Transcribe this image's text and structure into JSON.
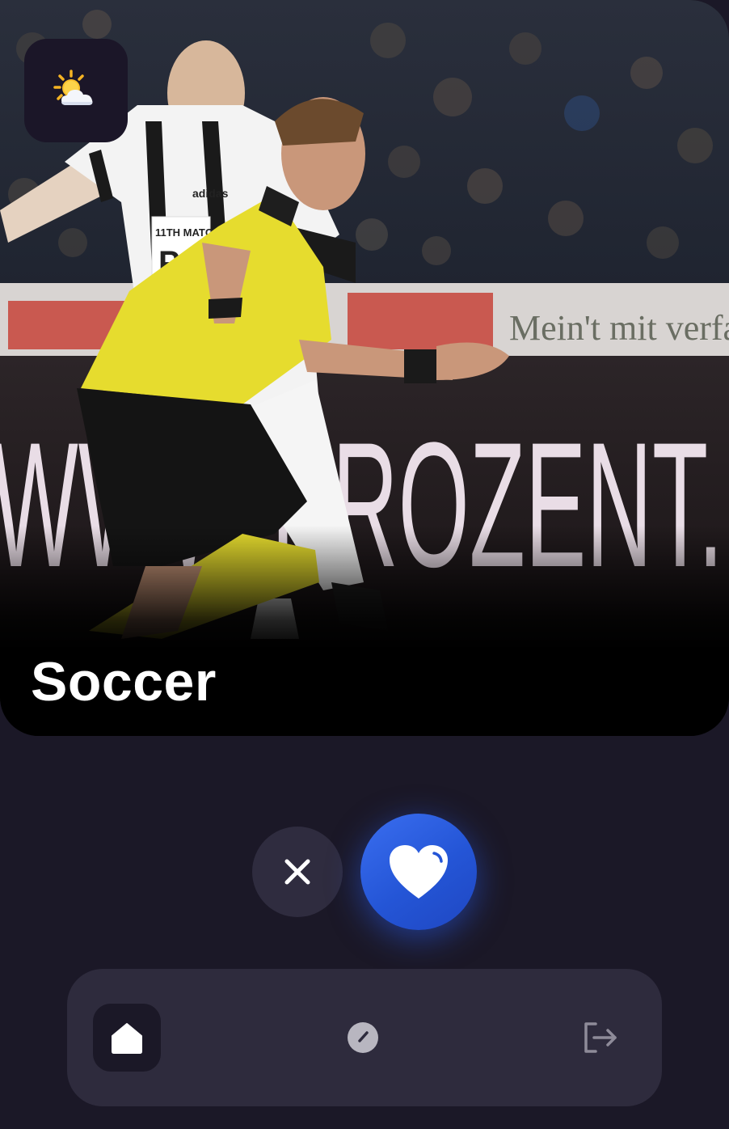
{
  "card": {
    "title": "Soccer",
    "image_icon": "soccer-match-photo",
    "badge_icon": "partly-sunny-weather-icon",
    "ad_board_text": "WWW.PROZENT.",
    "banner_text": "Mein't mit verfan",
    "jersey_text": "11TH MATCH",
    "jersey_text_2": "PO",
    "jersey_brand": "adidas"
  },
  "actions": {
    "dismiss_icon": "close-icon",
    "like_icon": "heart-icon"
  },
  "nav": {
    "items": [
      {
        "icon": "home-icon",
        "active": true
      },
      {
        "icon": "compass-icon",
        "active": false
      },
      {
        "icon": "logout-icon",
        "active": false
      }
    ]
  },
  "colors": {
    "background": "#1b1827",
    "nav_background": "#2e2b3d",
    "dismiss_button": "#2f2c3f",
    "like_button": "#2455d6",
    "jersey_yellow": "#e8df2a",
    "text": "#ffffff"
  }
}
